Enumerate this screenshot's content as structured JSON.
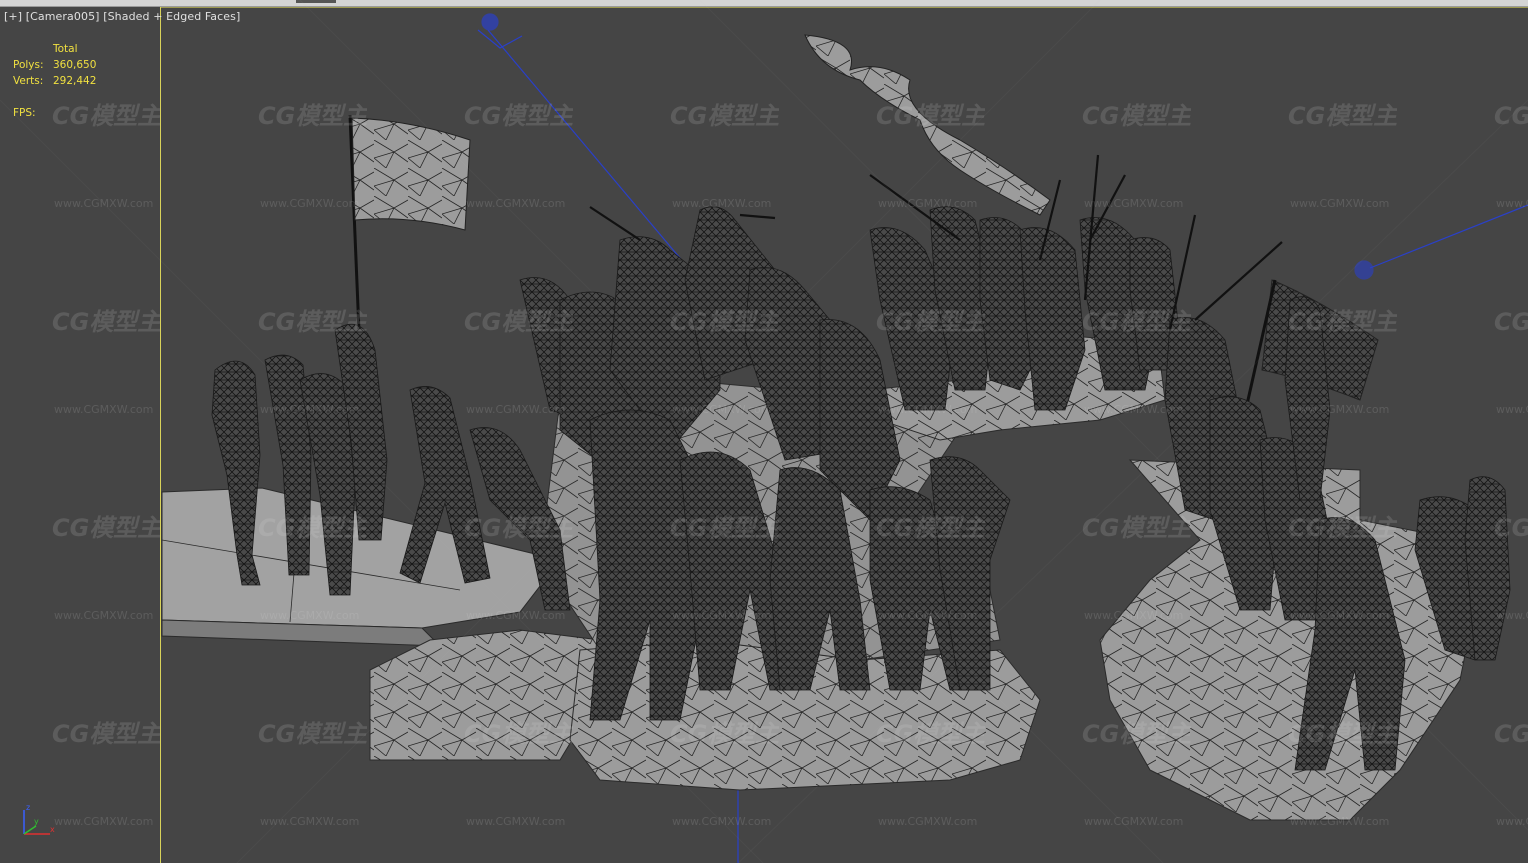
{
  "viewport": {
    "menu_plus": "[+]",
    "camera": "[Camera005]",
    "shading": "[Shaded + Edged Faces]"
  },
  "stats": {
    "header": "Total",
    "polys_label": "Polys:",
    "polys_value": "360,650",
    "verts_label": "Verts:",
    "verts_value": "292,442",
    "fps_label": "FPS:"
  },
  "watermark": {
    "logo": "CG模型主",
    "url": "www.CGMXW.com"
  },
  "gizmo": {
    "x_label": "x",
    "y_label": "y",
    "z_label": "z"
  },
  "colors": {
    "viewport_bg": "#454545",
    "stats_text": "#f0e040",
    "safe_frame": "#d8d25a",
    "camera_line": "#2a40c8"
  }
}
